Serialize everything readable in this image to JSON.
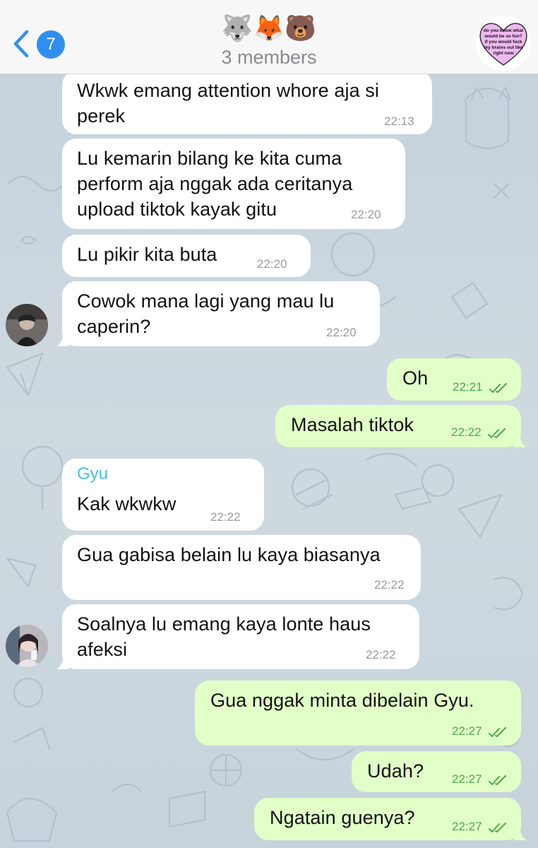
{
  "header": {
    "unread_count": "7",
    "title_emoji": "🐺🦊🐻",
    "subtitle": "3 members",
    "avatar_caption": "do you know what would be so fun? if you would fuck my brains out like right now"
  },
  "messages": [
    {
      "dir": "in",
      "text": "Wkwk emang attention whore aja si\nperek",
      "time": "22:13"
    },
    {
      "dir": "in",
      "text": "Lu kemarin bilang ke kita cuma\nperform aja nggak ada ceritanya\nupload tiktok kayak gitu",
      "time": "22:20"
    },
    {
      "dir": "in",
      "text": "Lu pikir kita buta",
      "time": "22:20"
    },
    {
      "dir": "in",
      "text": "Cowok mana lagi yang mau lu\ncaperin?",
      "time": "22:20"
    },
    {
      "dir": "out",
      "text": "Oh",
      "time": "22:21"
    },
    {
      "dir": "out",
      "text": "Masalah tiktok",
      "time": "22:22"
    },
    {
      "dir": "in",
      "sender": "Gyu",
      "text": "Kak wkwkw",
      "time": "22:22"
    },
    {
      "dir": "in",
      "text": "Gua gabisa belain lu kaya biasanya",
      "time": "22:22"
    },
    {
      "dir": "in",
      "text": "Soalnya lu emang kaya lonte haus\nafeksi",
      "time": "22:22"
    },
    {
      "dir": "out",
      "text": "Gua nggak minta dibelain Gyu.",
      "time": "22:27"
    },
    {
      "dir": "out",
      "text": "Udah?",
      "time": "22:27"
    },
    {
      "dir": "out",
      "text": "Ngatain guenya?",
      "time": "22:27"
    }
  ],
  "colors": {
    "incoming_bubble": "#ffffff",
    "outgoing_bubble": "#e1ffc7",
    "outgoing_time": "#4ea848",
    "sender_name": "#46c2dc",
    "badge": "#2f8ff0"
  }
}
